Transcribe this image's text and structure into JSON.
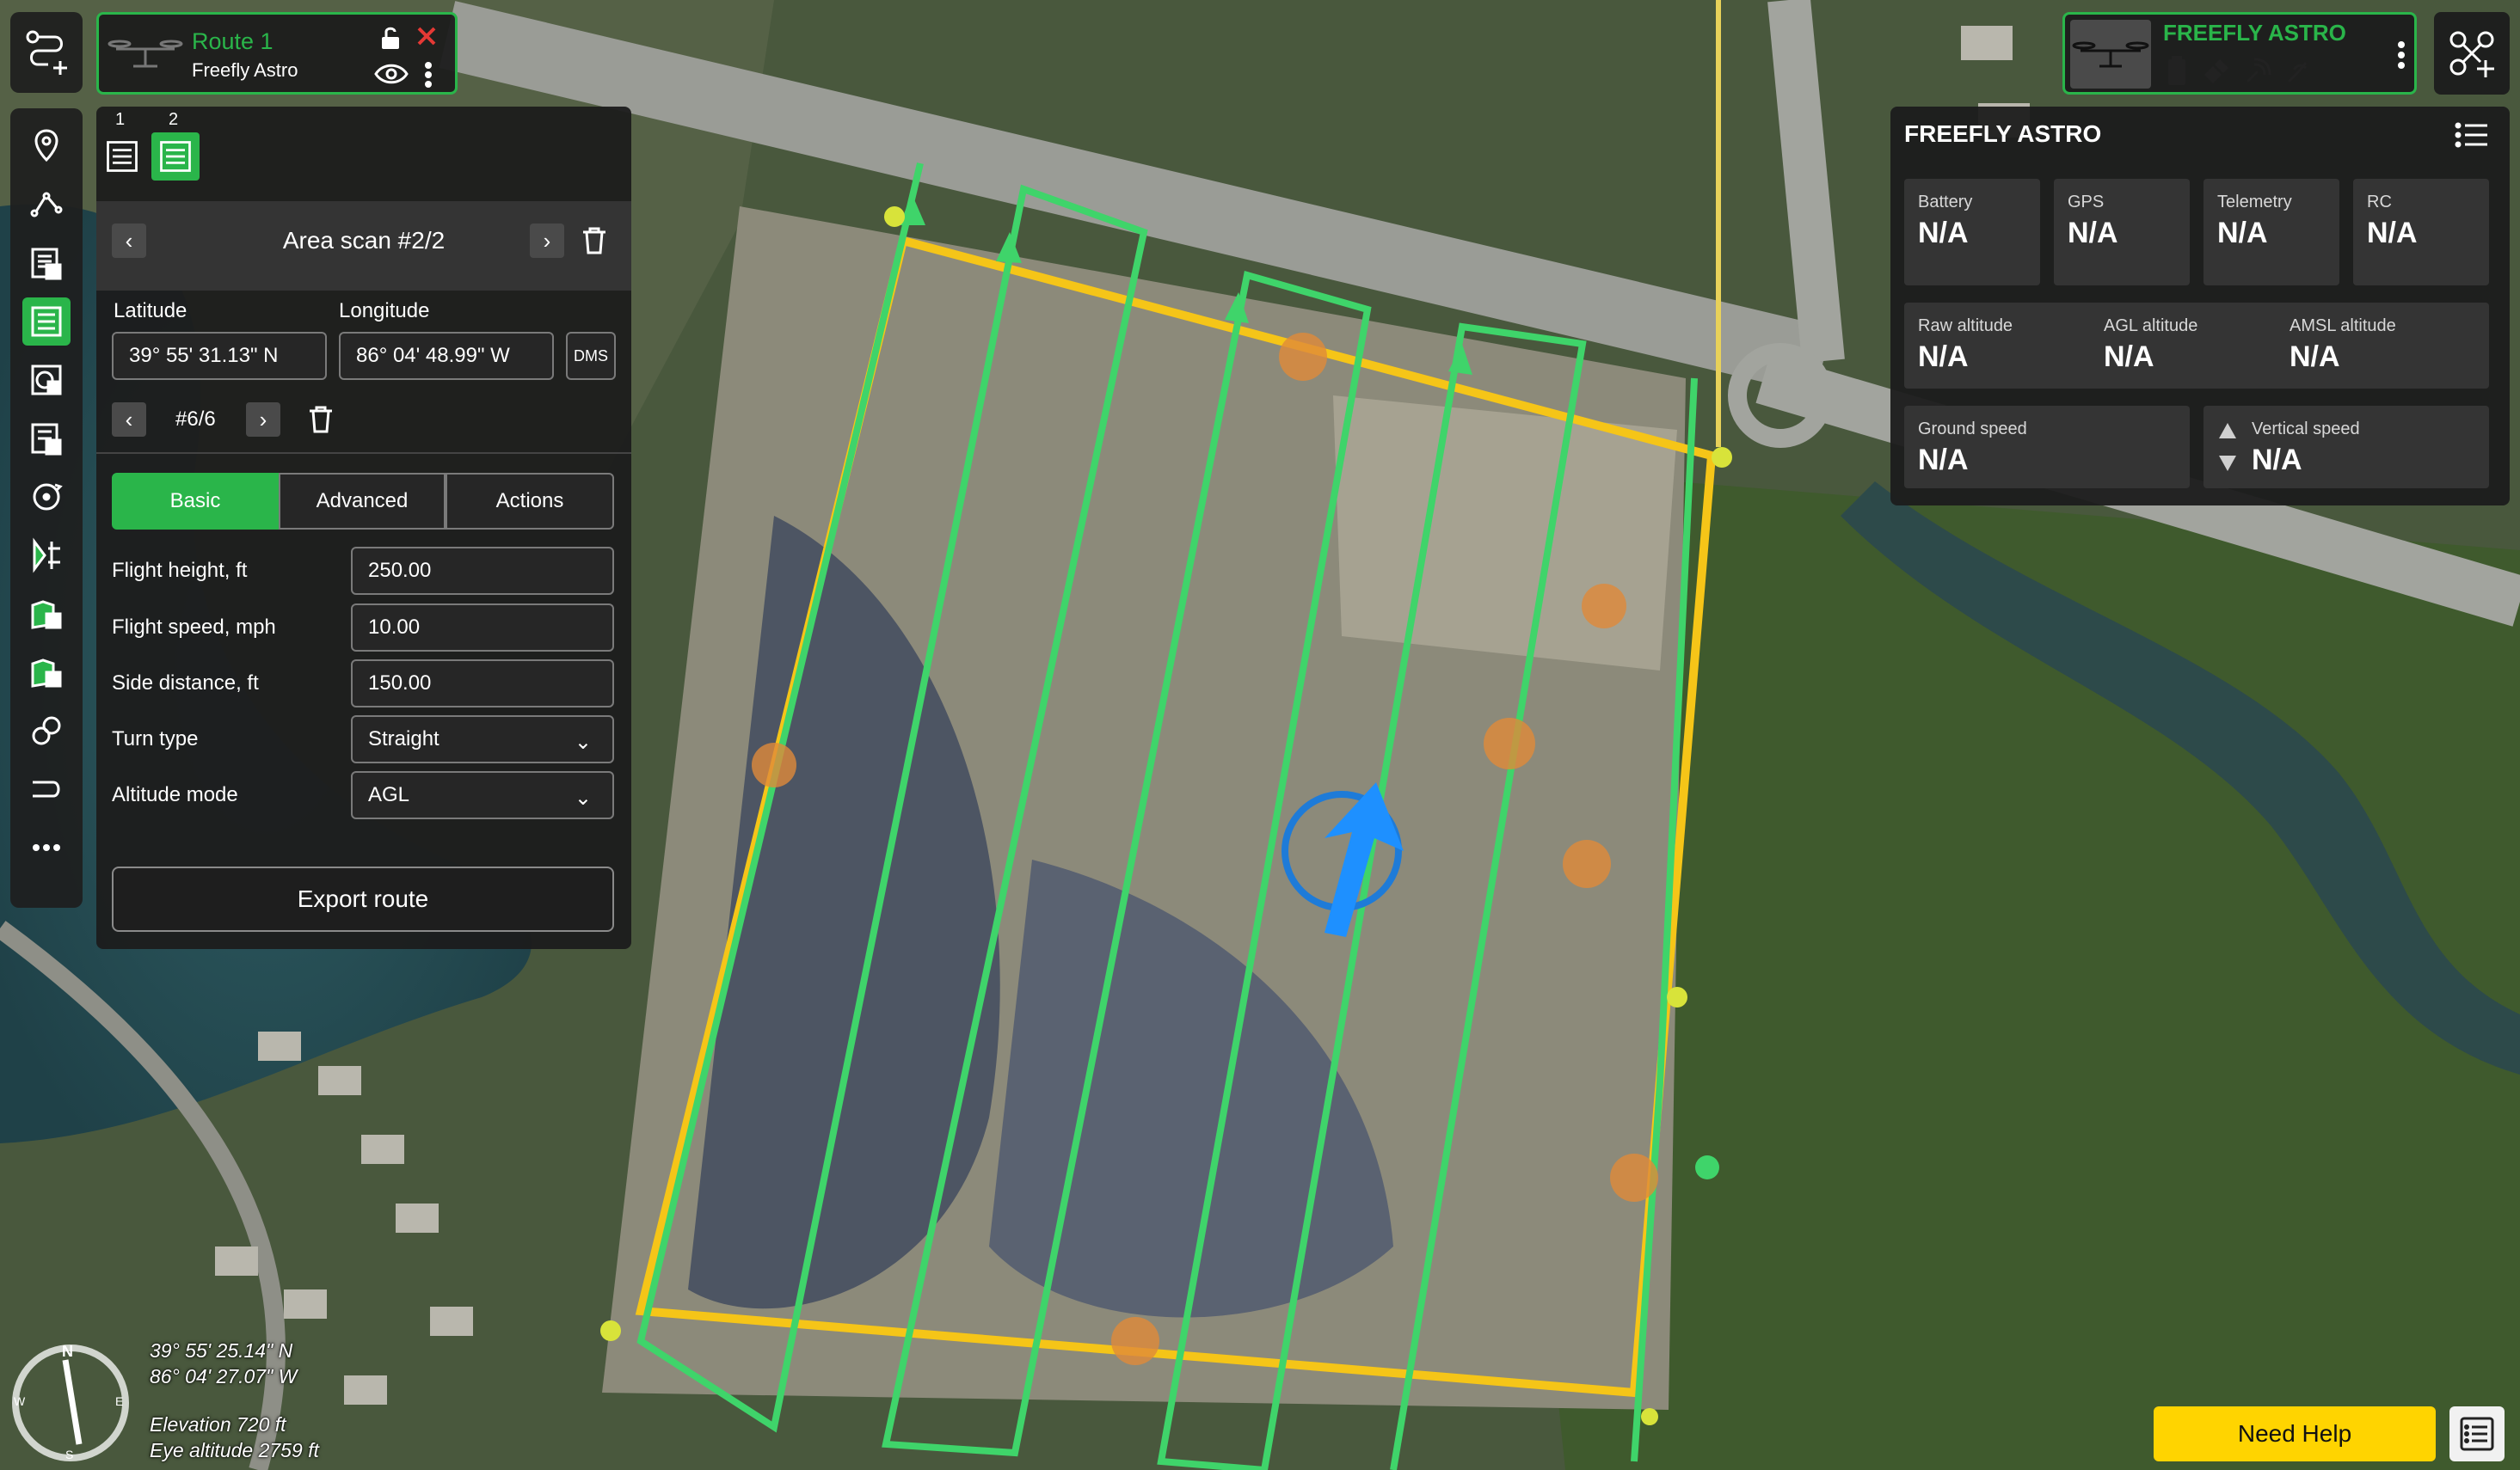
{
  "route": {
    "name": "Route 1",
    "drone": "Freefly Astro",
    "icons": [
      "unlock-icon",
      "close-icon",
      "eye-icon",
      "more-icon"
    ]
  },
  "scan": {
    "tabs": [
      {
        "number": "1"
      },
      {
        "number": "2"
      }
    ],
    "title": "Area scan #2/2",
    "latitude_label": "Latitude",
    "longitude_label": "Longitude",
    "latitude": "39° 55' 31.13\" N",
    "longitude": "86° 04' 48.99\" W",
    "dms_label": "DMS",
    "vertex": "#6/6",
    "segments": [
      "Basic",
      "Advanced",
      "Actions"
    ],
    "active_segment": "Basic",
    "params": [
      {
        "label": "Flight height, ft",
        "value": "250.00"
      },
      {
        "label": "Flight speed, mph",
        "value": "10.00"
      },
      {
        "label": "Side distance, ft",
        "value": "150.00"
      },
      {
        "label": "Turn type",
        "value": "Straight"
      },
      {
        "label": "Altitude mode",
        "value": "AGL"
      }
    ],
    "export_label": "Export route"
  },
  "drone_card": {
    "name": "FREEFLY ASTRO"
  },
  "telemetry": {
    "title": "FREEFLY ASTRO",
    "row1": [
      {
        "label": "Battery",
        "value": "N/A"
      },
      {
        "label": "GPS",
        "value": "N/A"
      },
      {
        "label": "Telemetry",
        "value": "N/A"
      },
      {
        "label": "RC",
        "value": "N/A"
      }
    ],
    "row2": [
      {
        "label": "Raw altitude",
        "value": "N/A"
      },
      {
        "label": "AGL altitude",
        "value": "N/A"
      },
      {
        "label": "AMSL altitude",
        "value": "N/A"
      }
    ],
    "row3": [
      {
        "label": "Ground speed",
        "value": "N/A"
      },
      {
        "label": "Vertical speed",
        "value": "N/A"
      }
    ]
  },
  "map_info": {
    "lat": "39° 55' 25.14\" N",
    "lon": "86° 04' 27.07\" W",
    "elevation": "Elevation 720 ft",
    "eye_altitude": "Eye altitude 2759 ft",
    "compass": {
      "n": "N",
      "s": "S",
      "e": "E",
      "w": "W"
    }
  },
  "help_label": "Need Help",
  "colors": {
    "accent": "#2ab54a",
    "boundary": "#f5c518",
    "path": "#3fd46a",
    "drone": "#1e90ff",
    "help": "#ffd400"
  }
}
